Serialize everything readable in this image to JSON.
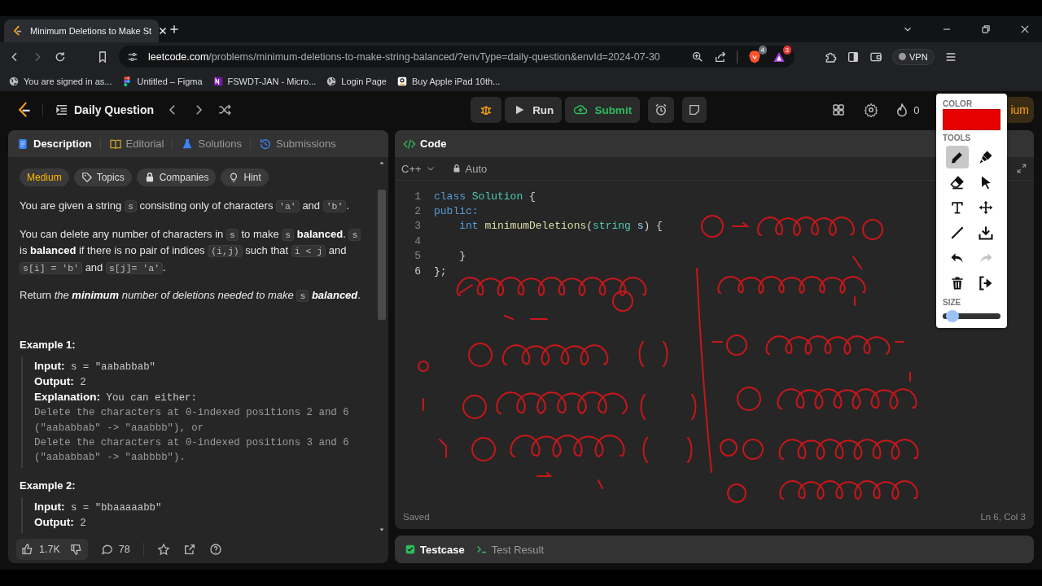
{
  "browser": {
    "tab": {
      "title": "Minimum Deletions to Make St"
    },
    "address": {
      "host": "leetcode.com",
      "path": "/problems/minimum-deletions-to-make-string-balanced/?envType=daily-question&envId=2024-07-30"
    },
    "badges": [
      "4",
      "3"
    ],
    "vpn": "VPN"
  },
  "bookmarks": [
    {
      "label": "You are signed in as...",
      "kind": "globe"
    },
    {
      "label": "Untitled – Figma",
      "kind": "figma"
    },
    {
      "label": "FSWDT-JAN - Micro...",
      "kind": "notebook"
    },
    {
      "label": "Login Page",
      "kind": "globe"
    },
    {
      "label": "Buy Apple iPad 10th...",
      "kind": "store"
    }
  ],
  "nav": {
    "title": "Daily Question",
    "run": "Run",
    "submit": "Submit",
    "streak": "0",
    "premium": "ium"
  },
  "problem": {
    "tabs": [
      {
        "label": "Description",
        "kind": "description",
        "selected": true
      },
      {
        "label": "Editorial",
        "kind": "editorial",
        "selected": false
      },
      {
        "label": "Solutions",
        "kind": "solutions",
        "selected": false
      },
      {
        "label": "Submissions",
        "kind": "submissions",
        "selected": false
      }
    ],
    "tags": [
      {
        "label": "Medium",
        "kind": "difficulty"
      },
      {
        "label": "Topics",
        "kind": "topics"
      },
      {
        "label": "Companies",
        "kind": "companies"
      },
      {
        "label": "Hint",
        "kind": "hint"
      }
    ],
    "paragraphs": [
      {
        "segments": [
          {
            "kind": "text",
            "text": "You are given a string "
          },
          {
            "kind": "code",
            "text": "s"
          },
          {
            "kind": "text",
            "text": " consisting only of characters "
          },
          {
            "kind": "code",
            "text": "'a'"
          },
          {
            "kind": "text",
            "text": " and "
          },
          {
            "kind": "code",
            "text": "'b'"
          },
          {
            "kind": "text",
            "text": "."
          }
        ]
      },
      {
        "segments": [
          {
            "kind": "text",
            "text": "You can delete any number of characters in "
          },
          {
            "kind": "code",
            "text": "s"
          },
          {
            "kind": "text",
            "text": " to make "
          },
          {
            "kind": "code",
            "text": "s"
          },
          {
            "kind": "text",
            "text": " **balanced**. "
          },
          {
            "kind": "code",
            "text": "s"
          },
          {
            "kind": "text",
            "text": " is **balanced** if there is no pair of indices "
          },
          {
            "kind": "code",
            "text": "(i,j)"
          },
          {
            "kind": "text",
            "text": " such that "
          },
          {
            "kind": "code",
            "text": "i < j"
          },
          {
            "kind": "text",
            "text": " and "
          },
          {
            "kind": "code",
            "text": "s[i] = 'b'"
          },
          {
            "kind": "text",
            "text": " and "
          },
          {
            "kind": "code",
            "text": "s[j]= 'a'"
          },
          {
            "kind": "text",
            "text": "."
          }
        ]
      },
      {
        "segments": [
          {
            "kind": "text",
            "text": "Return "
          },
          {
            "kind": "italic",
            "text": "the **minimum** number of deletions needed to make "
          },
          {
            "kind": "code",
            "text": "s"
          },
          {
            "kind": "italic",
            "text": " **balanced**"
          },
          {
            "kind": "text",
            "text": "."
          }
        ]
      }
    ],
    "examples": [
      {
        "title": "Example 1:",
        "lines": [
          {
            "label": "Input:",
            "text": "s = \"aababbab\""
          },
          {
            "label": "Output:",
            "text": "2"
          },
          {
            "label": "Explanation:",
            "text": "You can either:"
          },
          {
            "text": "Delete the characters at 0-indexed positions 2 and 6"
          },
          {
            "text": "(\"aababbab\" -> \"aaabbb\"), or"
          },
          {
            "text": "Delete the characters at 0-indexed positions 3 and 6"
          },
          {
            "text": "(\"aababbab\" -> \"aabbbb\")."
          }
        ]
      },
      {
        "title": "Example 2:",
        "lines": [
          {
            "label": "Input:",
            "text": "s = \"bbaaaaabb\""
          },
          {
            "label": "Output:",
            "text": "2"
          }
        ]
      }
    ],
    "likes": "1.7K",
    "comments": "78"
  },
  "editor": {
    "title": "Code",
    "language": "C++",
    "mode": "Auto",
    "lines": [
      {
        "number": "1",
        "tokens": [
          {
            "kind": "keyword",
            "text": "class"
          },
          {
            "kind": "type",
            "text": " Solution"
          },
          {
            "kind": "plain",
            "text": " {"
          }
        ]
      },
      {
        "number": "2",
        "tokens": [
          {
            "kind": "keyword",
            "text": "public:"
          }
        ]
      },
      {
        "number": "3",
        "tokens": [
          {
            "kind": "keyword",
            "text": "    int"
          },
          {
            "kind": "function",
            "text": " minimumDeletions"
          },
          {
            "kind": "plain",
            "text": "("
          },
          {
            "kind": "type",
            "text": "string"
          },
          {
            "kind": "param",
            "text": " s"
          },
          {
            "kind": "plain",
            "text": ") {"
          }
        ]
      },
      {
        "number": "4"
      },
      {
        "number": "5",
        "tokens": [
          {
            "kind": "plain",
            "text": "    }"
          }
        ]
      },
      {
        "number": "6",
        "tokens": [
          {
            "kind": "plain",
            "text": "};"
          }
        ]
      }
    ],
    "status": "Saved",
    "cursor": "Ln 6, Col 3"
  },
  "console_tabs": [
    {
      "label": "Testcase",
      "kind": "testcase",
      "selected": true
    },
    {
      "label": "Test Result",
      "kind": "result",
      "selected": false
    }
  ],
  "palette": {
    "color_label": "COLOR",
    "color": "#e60000",
    "tools_label": "TOOLS",
    "tools": [
      {
        "kind": "pencil",
        "selected": true,
        "disabled": false
      },
      {
        "kind": "marker",
        "selected": false,
        "disabled": false
      },
      {
        "kind": "eraser",
        "selected": false,
        "disabled": false
      },
      {
        "kind": "pointer",
        "selected": false,
        "disabled": false
      },
      {
        "kind": "text",
        "selected": false,
        "disabled": false
      },
      {
        "kind": "move",
        "selected": false,
        "disabled": false
      },
      {
        "kind": "line",
        "selected": false,
        "disabled": false
      },
      {
        "kind": "download",
        "selected": false,
        "disabled": false
      },
      {
        "kind": "undo",
        "selected": false,
        "disabled": false
      },
      {
        "kind": "redo",
        "selected": false,
        "disabled": true
      },
      {
        "kind": "trash",
        "selected": false,
        "disabled": false
      },
      {
        "kind": "exit",
        "selected": false,
        "disabled": false
      }
    ],
    "size_label": "SIZE",
    "level": 0.08
  }
}
